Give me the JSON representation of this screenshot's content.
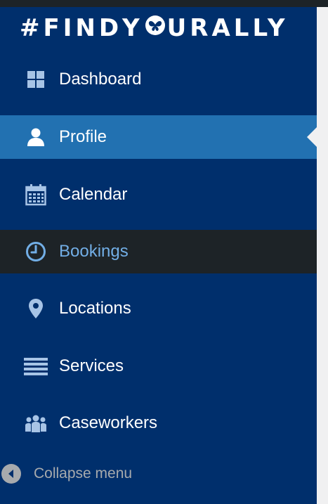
{
  "brand": {
    "logo_prefix": "#FIND",
    "logo_heart": "Y",
    "logo_o": "O",
    "logo_mid": "UR",
    "logo_suffix": "ALLY"
  },
  "colors": {
    "sidebar_bg": "#002f6c",
    "active_bg": "#2271b1",
    "hover_bg": "#1d2327",
    "hover_text": "#72aee6",
    "icon_color": "#a7c4e6",
    "collapse_text": "#a7aaad"
  },
  "menu": {
    "items": [
      {
        "label": "Dashboard",
        "icon": "dashboard-icon"
      },
      {
        "label": "Profile",
        "icon": "user-icon",
        "state": "active"
      },
      {
        "label": "Calendar",
        "icon": "calendar-icon"
      },
      {
        "label": "Bookings",
        "icon": "clock-icon",
        "state": "hover"
      },
      {
        "label": "Locations",
        "icon": "location-pin-icon"
      },
      {
        "label": "Services",
        "icon": "list-icon"
      },
      {
        "label": "Caseworkers",
        "icon": "groups-icon"
      }
    ],
    "collapse_label": "Collapse menu"
  }
}
